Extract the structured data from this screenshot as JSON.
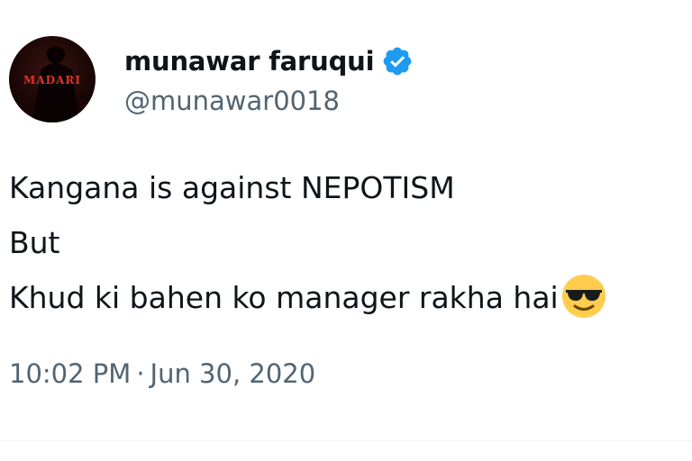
{
  "avatar": {
    "logo_text": "MADARI"
  },
  "user": {
    "display_name": "munawar faruqui",
    "handle": "@munawar0018",
    "verified_icon": "verified-badge-icon"
  },
  "tweet": {
    "lines": [
      "Kangana is against NEPOTISM",
      "But",
      "Khud ki bahen ko manager rakha hai"
    ],
    "emoji": "smiling-face-with-sunglasses"
  },
  "meta": {
    "time": "10:02 PM",
    "separator": "·",
    "date": "Jun 30, 2020"
  },
  "colors": {
    "text_primary": "#0f1419",
    "text_secondary": "#536471",
    "verified_blue": "#1d9bf0",
    "divider": "#eff3f4"
  }
}
